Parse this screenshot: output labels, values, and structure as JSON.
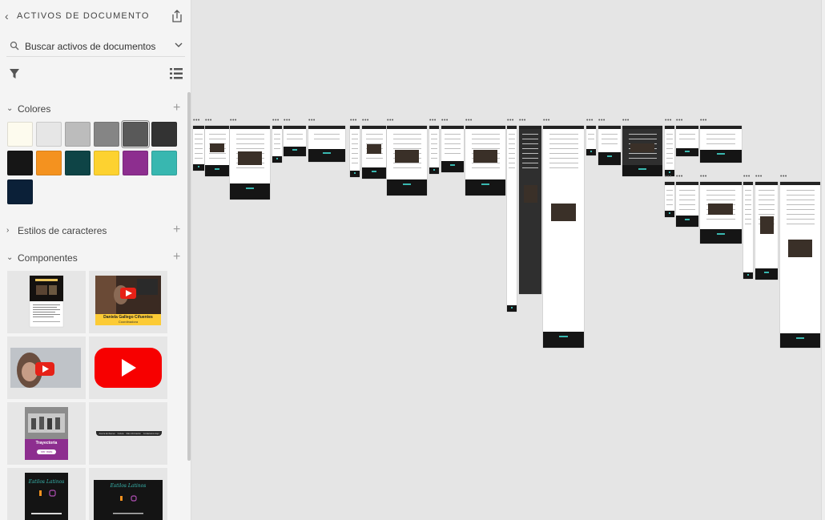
{
  "sidebar": {
    "title": "ACTIVOS DE DOCUMENTO",
    "search": {
      "placeholder": "Buscar activos de documentos",
      "value": ""
    },
    "sections": {
      "colors": {
        "label": "Colores"
      },
      "char_styles": {
        "label": "Estilos de caracteres"
      },
      "components": {
        "label": "Componentes"
      }
    },
    "colors": [
      "#fdfbee",
      "#e6e6e6",
      "#bcbcbc",
      "#858585",
      "#595959",
      "#333333",
      "#161616",
      "#f4921f",
      "#0e4446",
      "#fdd230",
      "#8d2e8f",
      "#38b7b0",
      "#0b2038"
    ],
    "selected_color_index": 4,
    "components": [
      {
        "kind": "poster"
      },
      {
        "kind": "video-card",
        "caption_title": "Daniela Gallego Cifuentes",
        "caption_sub": "Coordinadora"
      },
      {
        "kind": "video-thumb"
      },
      {
        "kind": "youtube-button"
      },
      {
        "kind": "history-card",
        "title": "Trayectoria",
        "button": "Ver más"
      },
      {
        "kind": "nav-bar",
        "items": [
          "Acerca del Ateneo",
          "Cultura",
          "Más información",
          "Contáctanos Aquí"
        ]
      },
      {
        "kind": "footer-tall",
        "logo": "Estilos Latinos"
      },
      {
        "kind": "footer-wide",
        "logo": "Estilos Latinos"
      }
    ]
  }
}
